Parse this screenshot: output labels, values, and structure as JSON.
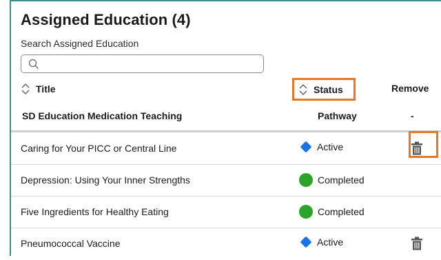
{
  "panel": {
    "title": "Assigned Education (4)",
    "search_label": "Search Assigned Education",
    "search_placeholder": ""
  },
  "columns": {
    "title": "Title",
    "status": "Status",
    "remove": "Remove"
  },
  "group_row": {
    "title": "SD Education Medication Teaching",
    "status": "Pathway",
    "remove": "-"
  },
  "rows": [
    {
      "title": "Caring for Your PICC or Central Line",
      "status": "Active",
      "status_icon": "blue-diamond",
      "remove_icon": "trash-icon"
    },
    {
      "title": "Depression: Using Your Inner Strengths",
      "status": "Completed",
      "status_icon": "green-circle",
      "remove_icon": ""
    },
    {
      "title": "Five Ingredients for Healthy Eating",
      "status": "Completed",
      "status_icon": "green-circle",
      "remove_icon": ""
    },
    {
      "title": "Pneumococcal Vaccine",
      "status": "Active",
      "status_icon": "blue-diamond",
      "remove_icon": "trash-icon"
    }
  ],
  "colors": {
    "accent_highlight": "#e87722",
    "active": "#1a73e8",
    "completed": "#2aa52a",
    "frame": "#3d8f8f"
  }
}
